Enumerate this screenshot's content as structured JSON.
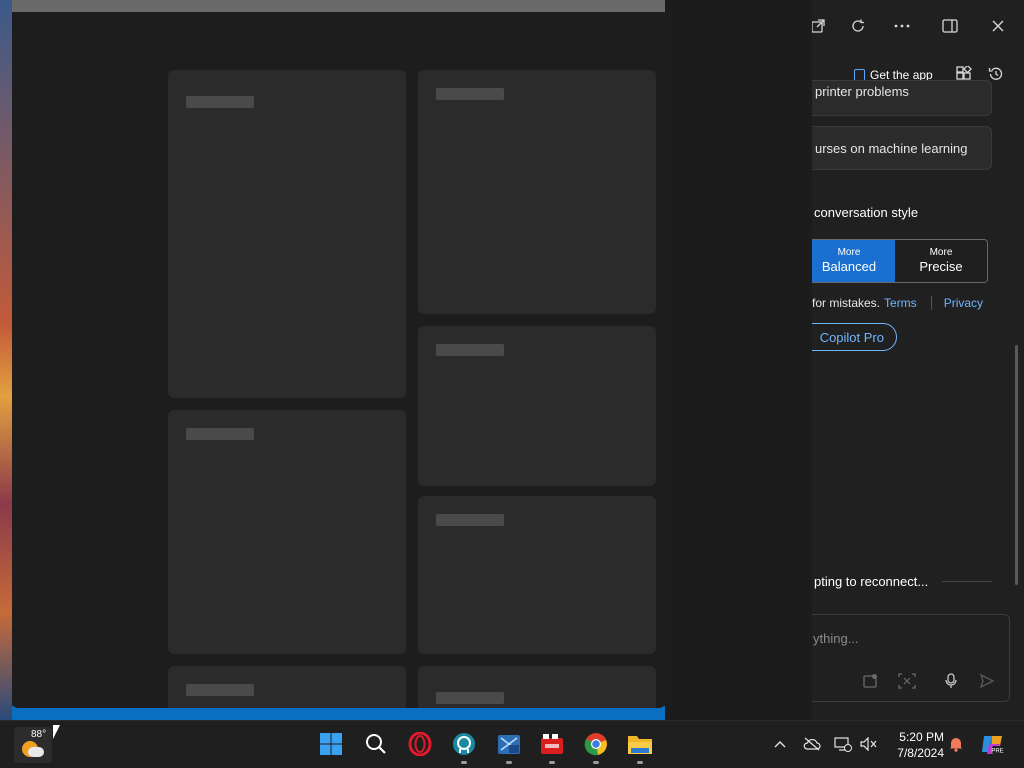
{
  "copilot": {
    "get_app_label": "Get the app",
    "suggestions": [
      {
        "text": "printer problems"
      },
      {
        "text": "urses on machine learning"
      }
    ],
    "style_heading": "conversation style",
    "styles": [
      {
        "small": "More",
        "big": "Balanced",
        "active": true
      },
      {
        "small": "More",
        "big": "Precise",
        "active": false
      }
    ],
    "notice_text": "for mistakes.",
    "terms_link": "Terms",
    "privacy_link": "Privacy",
    "pro_button_label": "Copilot Pro",
    "reconnect_text": "pting to reconnect...",
    "input_placeholder": "ything..."
  },
  "taskbar": {
    "weather_temp": "88°",
    "clock_time": "5:20 PM",
    "clock_date": "7/8/2024"
  },
  "colors": {
    "accent_blue": "#1a6fd0",
    "link_blue": "#6fb6ff",
    "panel_bg": "#202020",
    "card_bg": "#2b2b2b"
  }
}
